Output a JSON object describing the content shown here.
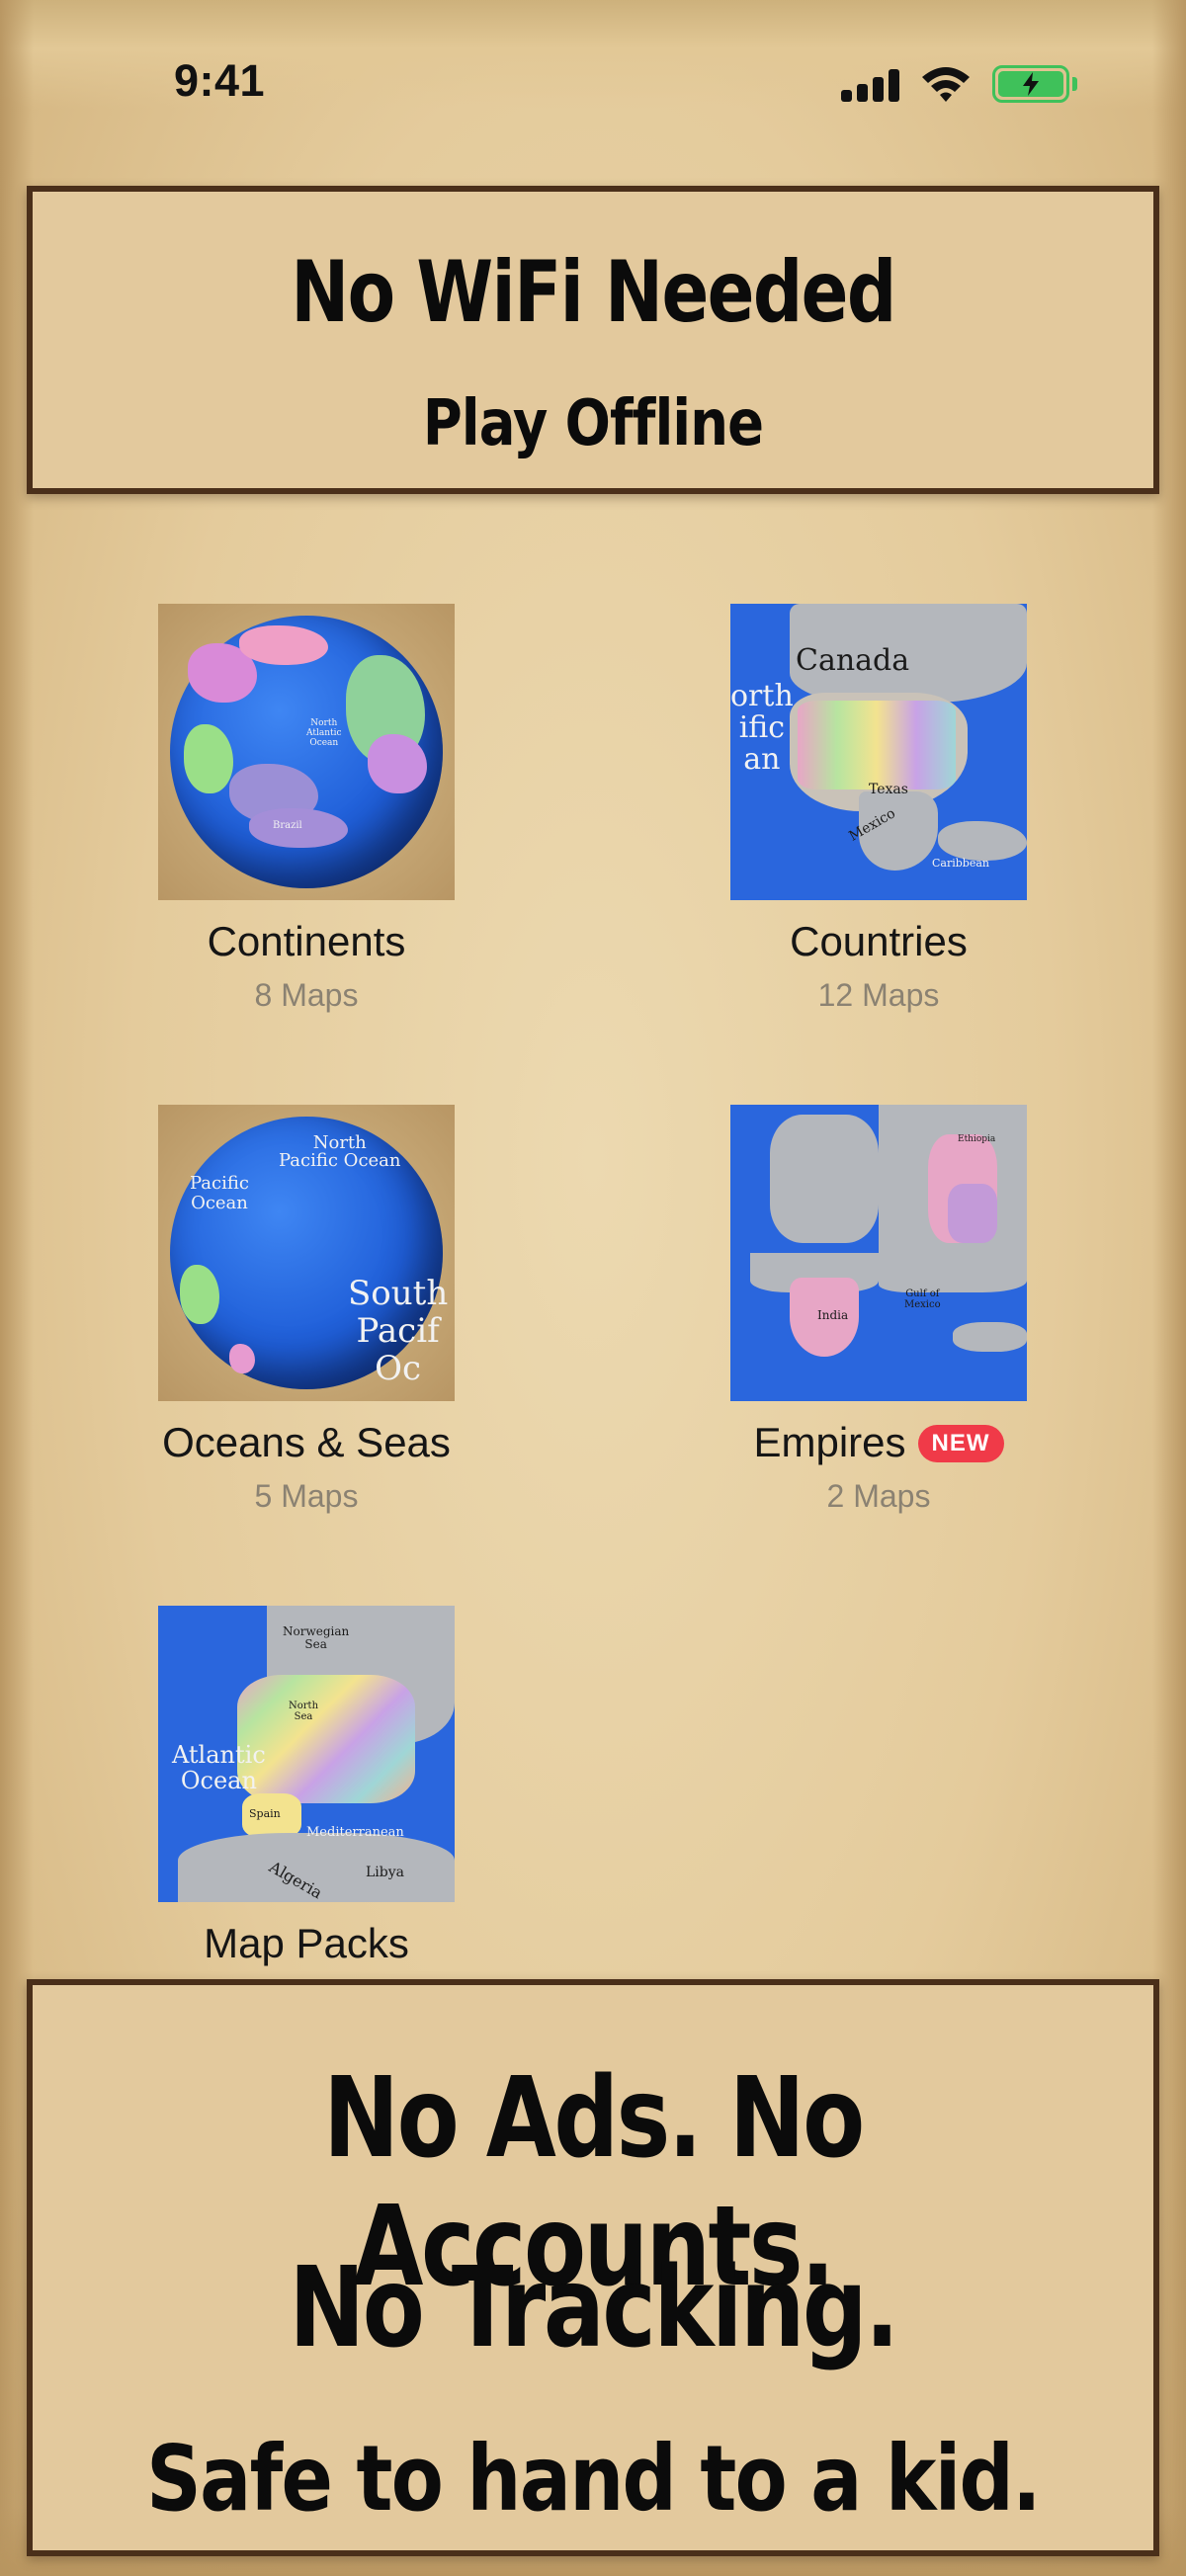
{
  "status_bar": {
    "time": "9:41",
    "icons": [
      "signal-icon",
      "wifi-icon",
      "battery-charging-icon"
    ],
    "battery_color": "#3fc15a"
  },
  "top_banner": {
    "line1": "No WiFi Needed",
    "line2": "Play Offline"
  },
  "categories": [
    {
      "label": "Continents",
      "count": "8 Maps",
      "icon": "globe-atlantic-icon",
      "map_labels": [
        "North Atlantic Ocean",
        "Brazil"
      ]
    },
    {
      "label": "Countries",
      "count": "12 Maps",
      "icon": "north-america-map-icon",
      "map_labels": [
        "Canada",
        "North Pacific Ocean",
        "Texas",
        "Mexico",
        "Caribbean Sea"
      ]
    },
    {
      "label": "Oceans & Seas",
      "count": "5 Maps",
      "icon": "globe-pacific-icon",
      "map_labels": [
        "North Pacific Ocean",
        "Pacific Ocean",
        "South Pacific Ocean"
      ]
    },
    {
      "label": "Empires",
      "badge": "NEW",
      "count": "2 Maps",
      "icon": "empires-collage-icon",
      "map_labels": [
        "India",
        "Gulf of Mexico",
        "Ethiopia"
      ]
    },
    {
      "label": "Map Packs",
      "icon": "europe-map-icon",
      "map_labels": [
        "Norwegian Sea",
        "North Sea",
        "Atlantic Ocean",
        "Spain",
        "Mediterranean Sea",
        "Libya",
        "Algeria"
      ]
    }
  ],
  "bottom_banner": {
    "line1": "No Ads. No Accounts.",
    "line2": "No Tracking.",
    "line3": "Safe to hand to a kid."
  },
  "colors": {
    "parchment": "#e6cfa2",
    "banner_border": "#4a2f1a",
    "ocean": "#2a66dd",
    "badge": "#f03a48"
  }
}
